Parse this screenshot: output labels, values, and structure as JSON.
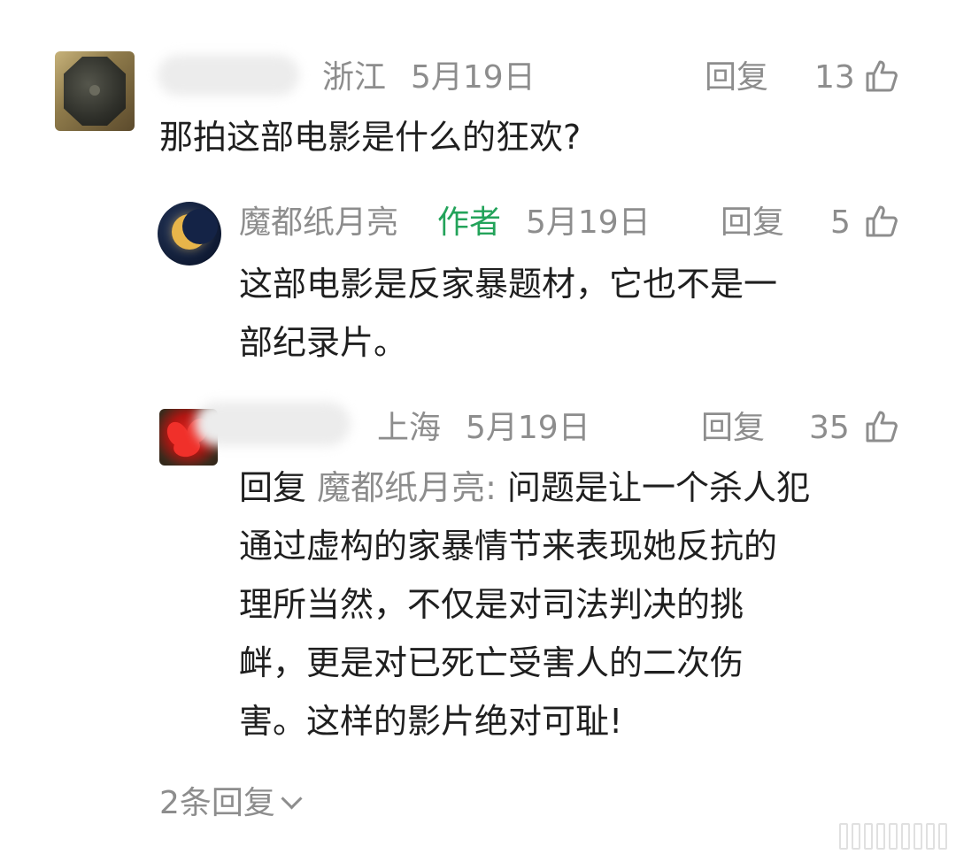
{
  "comments": [
    {
      "username": "",
      "location": "浙江",
      "date": "5月19日",
      "reply_label": "回复",
      "likes": "13",
      "text_lines": [
        "那拍这部电影是什么的狂欢?"
      ]
    },
    {
      "username": "魔都纸月亮",
      "author_badge": "作者",
      "date": "5月19日",
      "reply_label": "回复",
      "likes": "5",
      "text_lines": [
        "这部电影是反家暴题材，它也不是一",
        "部纪录片。"
      ]
    },
    {
      "username": "",
      "location": "上海",
      "date": "5月19日",
      "reply_label": "回复",
      "likes": "35",
      "reply_prefix": "回复 ",
      "reply_target": "魔都纸月亮:",
      "text_first": " 问题是让一个杀人犯",
      "text_lines": [
        "通过虚构的家暴情节来表现她反抗的",
        "理所当然，不仅是对司法判决的挑",
        "衅，更是对已死亡受害人的二次伤",
        "害。这样的影片绝对可耻!"
      ]
    }
  ],
  "more_replies": "2条回复",
  "icons": {
    "like": "thumbs-up-icon",
    "expand": "chevron-down-icon"
  },
  "colors": {
    "meta": "#8d8d8d",
    "author_badge": "#23a35a",
    "body": "#1f1f1f"
  }
}
